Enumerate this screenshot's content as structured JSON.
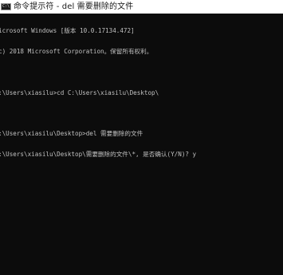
{
  "window": {
    "title": "命令提示符 - del  需要删除的文件"
  },
  "console": {
    "lines": [
      "icrosoft Windows [版本 10.0.17134.472]",
      "c) 2018 Microsoft Corporation。保留所有权利。",
      "",
      ":\\Users\\xiasilu>cd C:\\Users\\xiasilu\\Desktop\\",
      "",
      ":\\Users\\xiasilu\\Desktop>del 需要删除的文件",
      ":\\Users\\xiasilu\\Desktop\\需要删除的文件\\*, 是否确认(Y/N)? y"
    ]
  }
}
